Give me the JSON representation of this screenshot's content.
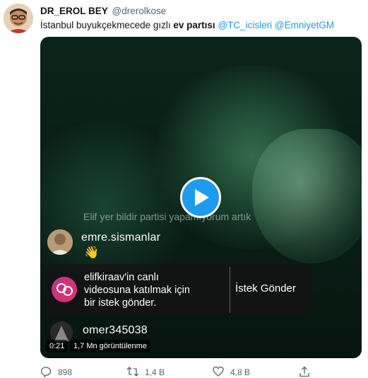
{
  "tweet": {
    "display_name": "DR_EROL BEY",
    "handle": "@drerolkose",
    "text_plain": "İstanbul buyukçekmecede gızlı ",
    "text_bold": "ev partısı",
    "mention_1": "@TC_icisleri",
    "mention_2": "@EmniyetGM"
  },
  "video": {
    "overlay_text": "Elif yer bildir partisi yapamıyorum artık",
    "comments": [
      {
        "username": "emre.sismanlar",
        "emoji": "👋"
      },
      {
        "username": "omer345038"
      }
    ],
    "request": {
      "text": "elifkiraav'in canlı\nvideosuna katılmak için\nbir istek gönder.",
      "button_label": "İstek Gönder"
    },
    "time": "0:21",
    "views": "1,7 Mn görüntülenme"
  },
  "actions": {
    "replies": "898",
    "retweets": "1,4 B",
    "likes": "4,8 B"
  },
  "colors": {
    "accent": "#1d9bf0",
    "muted": "#536471"
  }
}
